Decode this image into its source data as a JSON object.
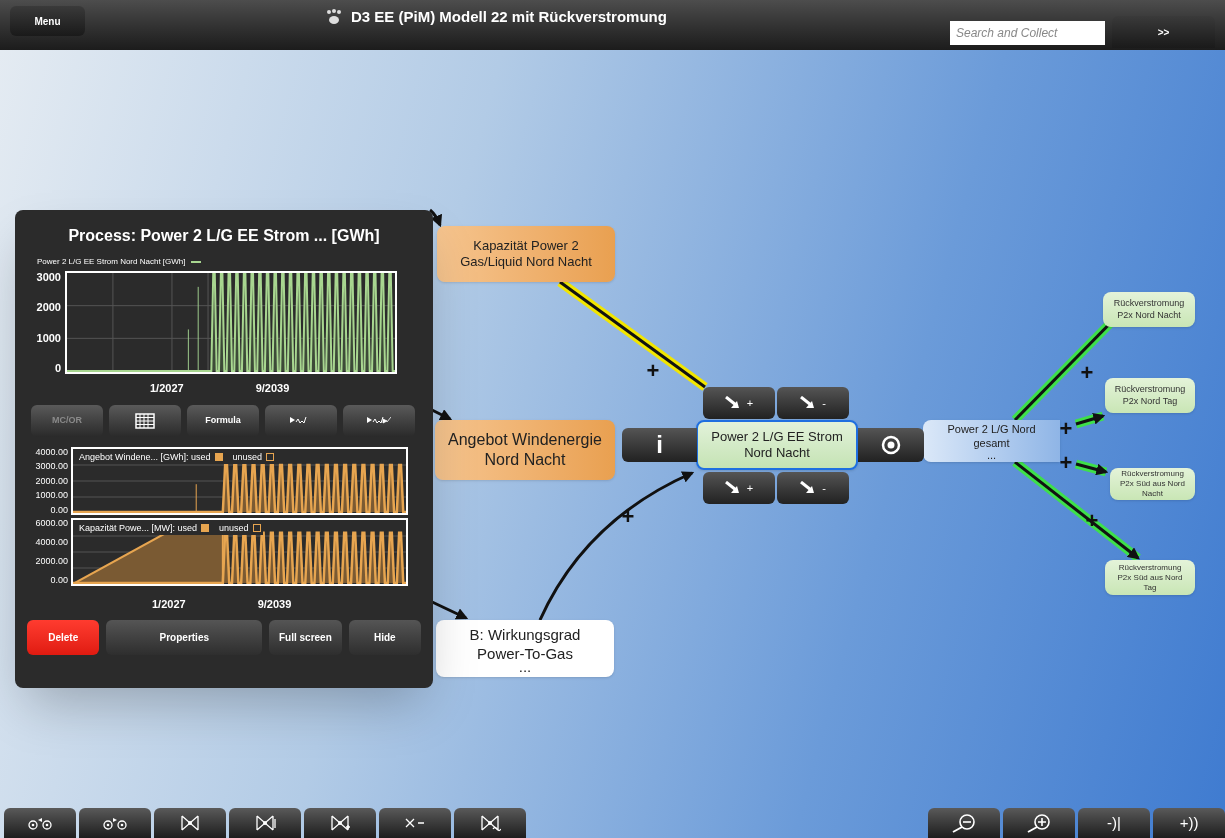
{
  "top_bar": {
    "menu_button": "Menu",
    "title": "D3 EE (PiM) Modell 22 mit Rückverstromung",
    "search": {
      "placeholder": "Search and Collect"
    },
    "go_button": ">>"
  },
  "edges": [
    {
      "kind": "line",
      "sign": "+",
      "color": "#f2e600"
    },
    {
      "kind": "arrow",
      "sign": "+"
    },
    {
      "kind": "arrow",
      "sign": "+",
      "color": "#3ee04a"
    },
    {
      "kind": "arrow",
      "sign": "+",
      "color": "#3ee04a"
    },
    {
      "kind": "arrow",
      "sign": "+",
      "color": "#3ee04a"
    },
    {
      "kind": "arrow",
      "sign": "+",
      "color": "#3ee04a"
    },
    {
      "kind": "arrow"
    },
    {
      "kind": "arrow"
    },
    {
      "kind": "arrow"
    }
  ],
  "nodes": [
    {
      "label": "Kapazität Power 2 Gas/Liquid Nord Nacht",
      "kind": "input",
      "selected": false
    },
    {
      "label": "Angebot Windenergie Nord Nacht",
      "kind": "input-large",
      "selected": false
    },
    {
      "label": "B: Wirkungsgrad Power-To-Gas",
      "kind": "parameter",
      "more": "...",
      "selected": false
    },
    {
      "label": "Power 2 L/G EE Strom Nord Nacht",
      "kind": "process",
      "selected": true
    },
    {
      "label": "Power 2 L/G Nord gesamt",
      "kind": "aggregate",
      "more": "...",
      "selected": false
    },
    {
      "label": "Rückverstromung P2x Nord Nacht",
      "kind": "output",
      "selected": false
    },
    {
      "label": "Rückverstromung P2x Nord Tag",
      "kind": "output",
      "selected": false
    },
    {
      "label": "Rückverstromung P2x Süd aus Nord Nacht",
      "kind": "output-small",
      "selected": false
    },
    {
      "label": "Rückverstromung P2x Süd aus Nord Tag",
      "kind": "output-small",
      "selected": false
    }
  ],
  "node_tools": {
    "info_button": "i",
    "link_buttons": [
      {
        "sign": "+"
      },
      {
        "sign": "-"
      },
      {
        "sign": "+"
      },
      {
        "sign": "-"
      }
    ]
  },
  "process_panel": {
    "title": "Process: Power 2 L/G EE Strom ... [GWh]",
    "chart": {
      "legend": "Power 2 L/G EE Strom Nord Nacht [GWh]",
      "y_labels": [
        "3000",
        "2000",
        "1000",
        "0"
      ],
      "x_labels": [
        "1/2027",
        "9/2039"
      ]
    },
    "tools": [
      {
        "kind": "text",
        "label": "MC/OR",
        "disabled": true
      },
      {
        "kind": "table",
        "disabled": false
      },
      {
        "kind": "text",
        "label": "Formula",
        "disabled": false
      },
      {
        "kind": "play-wave",
        "disabled": false
      },
      {
        "kind": "play-wave-double",
        "disabled": false
      }
    ],
    "usage_charts": [
      {
        "legend": "Angebot Windene... [GWh]: used",
        "unused": "unused",
        "y_labels": [
          "4000.00",
          "3000.00",
          "2000.00",
          "1000.00",
          "0.00"
        ],
        "kind": "spikes"
      },
      {
        "legend": "Kapazität Powe... [MW]: used",
        "unused": "unused",
        "y_labels": [
          "6000.00",
          "4000.00",
          "2000.00",
          "0.00"
        ],
        "kind": "ramp"
      }
    ],
    "x_labels": [
      "1/2027",
      "9/2039"
    ],
    "actions": [
      {
        "label": "Delete",
        "kind": "danger"
      },
      {
        "label": "Properties",
        "kind": "normal"
      },
      {
        "label": "Full screen",
        "kind": "normal"
      },
      {
        "label": "Hide",
        "kind": "normal"
      }
    ]
  },
  "bottom_toolbar": {
    "left": [
      {
        "kind": "circles-back"
      },
      {
        "kind": "circles-forward"
      },
      {
        "kind": "network"
      },
      {
        "kind": "network-down"
      },
      {
        "kind": "network-plus"
      },
      {
        "kind": "cross-minus"
      },
      {
        "kind": "network-loop"
      }
    ],
    "right": [
      {
        "kind": "zoom-out"
      },
      {
        "kind": "zoom-in"
      },
      {
        "kind": "text",
        "label": "-)|"
      },
      {
        "kind": "text",
        "label": "+))"
      }
    ]
  }
}
